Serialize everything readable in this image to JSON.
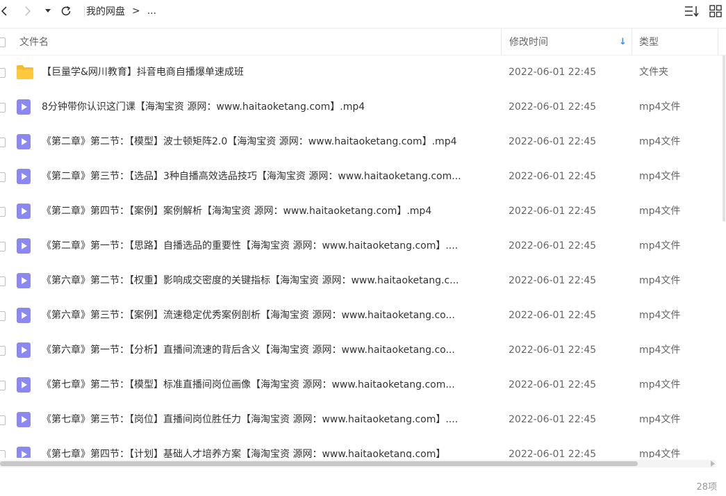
{
  "toolbar": {
    "back_icon": "chevron-left-icon",
    "forward_icon": "chevron-right-icon",
    "history_icon": "caret-down-icon",
    "refresh_icon": "refresh-icon",
    "sort_icon": "sort-list-icon",
    "view_icon": "grid-view-icon"
  },
  "breadcrumb": {
    "root": "我的网盘",
    "separator": ">",
    "ellipsis": "..."
  },
  "columns": {
    "name": "文件名",
    "modified": "修改时间",
    "type": "类型",
    "sort_indicator": "↓"
  },
  "colors": {
    "accent": "#3a8ee6",
    "folder": "#f7bb2d",
    "video": "#8b88f0"
  },
  "files": [
    {
      "name": "【巨量学&网川教育】抖音电商自播爆单速成班",
      "modified": "2022-06-01 22:45",
      "type": "文件夹",
      "icon": "folder-icon"
    },
    {
      "name": "8分钟带你认识这门课【海淘宝资 源网：www.haitaoketang.com】.mp4",
      "modified": "2022-06-01 22:45",
      "type": "mp4文件",
      "icon": "video-file-icon"
    },
    {
      "name": "《第二章》第二节：【模型】波士顿矩阵2.0【海淘宝资 源网：www.haitaoketang.com】.mp4",
      "modified": "2022-06-01 22:45",
      "type": "mp4文件",
      "icon": "video-file-icon"
    },
    {
      "name": "《第二章》第三节：【选品】3种自播高效选品技巧【海淘宝资 源网：www.haitaoketang.com...",
      "modified": "2022-06-01 22:45",
      "type": "mp4文件",
      "icon": "video-file-icon"
    },
    {
      "name": "《第二章》第四节：【案例】案例解析【海淘宝资 源网：www.haitaoketang.com】.mp4",
      "modified": "2022-06-01 22:45",
      "type": "mp4文件",
      "icon": "video-file-icon"
    },
    {
      "name": "《第二章》第一节：【思路】自播选品的重要性【海淘宝资 源网：www.haitaoketang.com】....",
      "modified": "2022-06-01 22:45",
      "type": "mp4文件",
      "icon": "video-file-icon"
    },
    {
      "name": "《第六章》第二节：【权重】影响成交密度的关键指标【海淘宝资 源网：www.haitaoketang.c...",
      "modified": "2022-06-01 22:45",
      "type": "mp4文件",
      "icon": "video-file-icon"
    },
    {
      "name": "《第六章》第三节：【案例】流速稳定优秀案例剖析【海淘宝资 源网：www.haitaoketang.co...",
      "modified": "2022-06-01 22:45",
      "type": "mp4文件",
      "icon": "video-file-icon"
    },
    {
      "name": "《第六章》第一节：【分析】直播间流速的背后含义【海淘宝资 源网：www.haitaoketang.co...",
      "modified": "2022-06-01 22:45",
      "type": "mp4文件",
      "icon": "video-file-icon"
    },
    {
      "name": "《第七章》第二节：【模型】标准直播间岗位画像【海淘宝资 源网：www.haitaoketang.com...",
      "modified": "2022-06-01 22:45",
      "type": "mp4文件",
      "icon": "video-file-icon"
    },
    {
      "name": "《第七章》第三节：【岗位】直播间岗位胜任力【海淘宝资 源网：www.haitaoketang.com】....",
      "modified": "2022-06-01 22:45",
      "type": "mp4文件",
      "icon": "video-file-icon"
    },
    {
      "name": "《第七章》第四节：【计划】基础人才培养方案【海淘宝资 源网：www.haitaoketang.com】",
      "modified": "2022-06-01 22:45",
      "type": "mp4文件",
      "icon": "video-file-icon"
    }
  ],
  "footer": {
    "item_count": "28项"
  }
}
